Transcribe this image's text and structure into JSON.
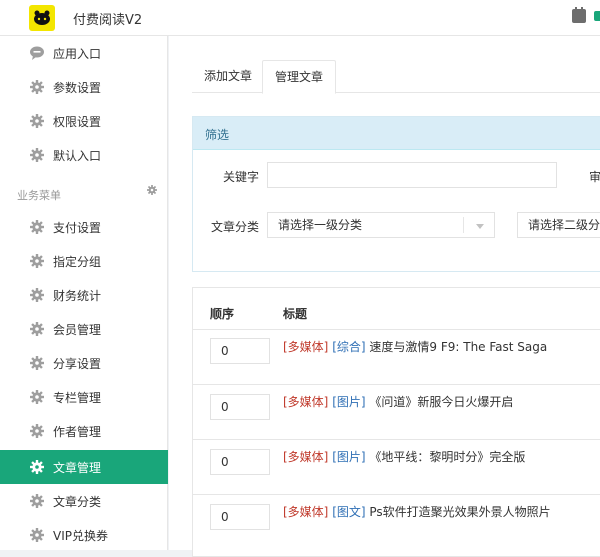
{
  "header": {
    "app_title": "付费阅读V2"
  },
  "sidebar": {
    "items_top": [
      {
        "label": "应用入口",
        "icon": "chat-bubble-icon"
      },
      {
        "label": "参数设置",
        "icon": "gear-icon"
      },
      {
        "label": "权限设置",
        "icon": "gear-icon"
      },
      {
        "label": "默认入口",
        "icon": "gear-icon"
      }
    ],
    "group_title": "业务菜单",
    "items_group": [
      {
        "label": "支付设置",
        "icon": "gear-icon"
      },
      {
        "label": "指定分组",
        "icon": "gear-icon"
      },
      {
        "label": "财务统计",
        "icon": "gear-icon"
      },
      {
        "label": "会员管理",
        "icon": "gear-icon"
      },
      {
        "label": "分享设置",
        "icon": "gear-icon"
      },
      {
        "label": "专栏管理",
        "icon": "gear-icon"
      },
      {
        "label": "作者管理",
        "icon": "gear-icon"
      },
      {
        "label": "文章管理",
        "icon": "gear-icon",
        "active": true
      },
      {
        "label": "文章分类",
        "icon": "gear-icon"
      },
      {
        "label": "VIP兑换券",
        "icon": "gear-icon"
      }
    ],
    "active_color": "#19a67a"
  },
  "tabs": [
    {
      "label": "添加文章"
    },
    {
      "label": "管理文章",
      "active": true
    }
  ],
  "filter": {
    "title": "筛选",
    "keyword_label": "关键字",
    "keyword_value": "",
    "review_label_partial": "审",
    "category_label": "文章分类",
    "category_level1": "请选择一级分类",
    "category_level2": "请选择二级分类"
  },
  "table": {
    "columns": [
      "顺序",
      "标题"
    ],
    "rows": [
      {
        "order": "0",
        "media": "[多媒体]",
        "category": "[综合]",
        "title": "速度与激情9 F9: The Fast Saga"
      },
      {
        "order": "0",
        "media": "[多媒体]",
        "category": "[图片]",
        "title": "《问道》新服今日火爆开启"
      },
      {
        "order": "0",
        "media": "[多媒体]",
        "category": "[图片]",
        "title": "《地平线：黎明时分》完全版"
      },
      {
        "order": "0",
        "media": "[多媒体]",
        "category": "[图文]",
        "title": "Ps软件打造聚光效果外景人物照片"
      }
    ]
  }
}
